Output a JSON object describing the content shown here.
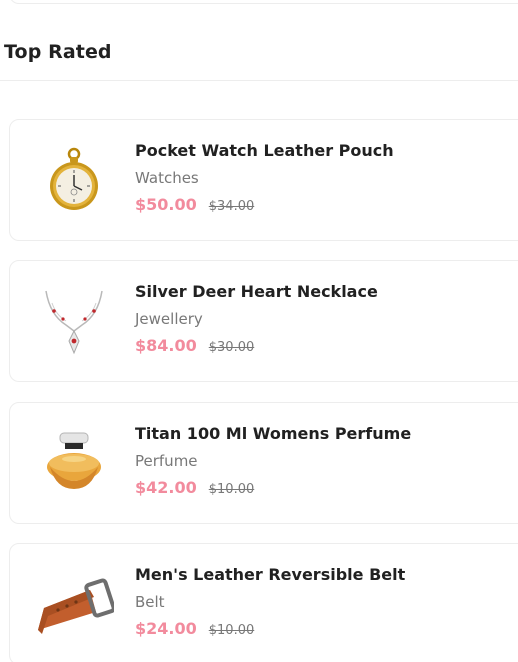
{
  "section": {
    "title": "Top Rated"
  },
  "products": [
    {
      "title": "Pocket Watch Leather Pouch",
      "category": "Watches",
      "price": "$50.00",
      "old_price": "$34.00",
      "icon": "pocket-watch-icon"
    },
    {
      "title": "Silver Deer Heart Necklace",
      "category": "Jewellery",
      "price": "$84.00",
      "old_price": "$30.00",
      "icon": "necklace-icon"
    },
    {
      "title": "Titan 100 Ml Womens Perfume",
      "category": "Perfume",
      "price": "$42.00",
      "old_price": "$10.00",
      "icon": "perfume-icon"
    },
    {
      "title": "Men's Leather Reversible Belt",
      "category": "Belt",
      "price": "$24.00",
      "old_price": "$10.00",
      "icon": "belt-icon"
    }
  ],
  "colors": {
    "accent": "#f28b9d",
    "text": "#212121",
    "muted": "#787878",
    "border": "#ededed"
  }
}
